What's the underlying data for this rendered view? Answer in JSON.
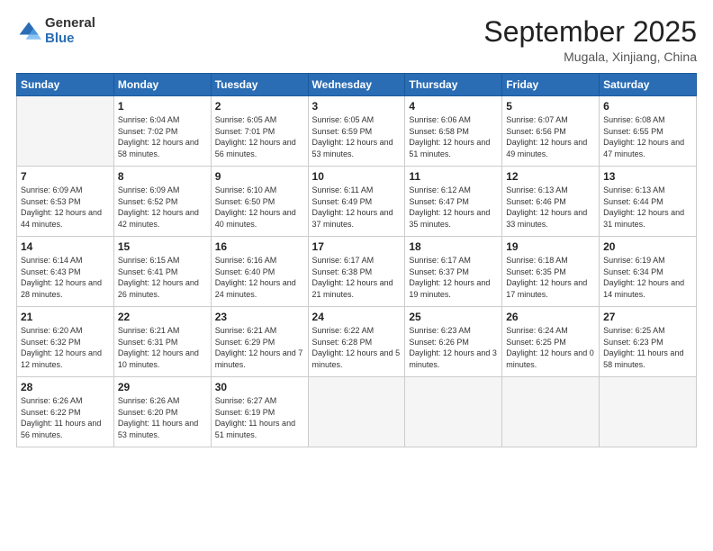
{
  "logo": {
    "general": "General",
    "blue": "Blue"
  },
  "title": "September 2025",
  "location": "Mugala, Xinjiang, China",
  "days_header": [
    "Sunday",
    "Monday",
    "Tuesday",
    "Wednesday",
    "Thursday",
    "Friday",
    "Saturday"
  ],
  "weeks": [
    [
      {
        "day": "",
        "sunrise": "",
        "sunset": "",
        "daylight": ""
      },
      {
        "day": "1",
        "sunrise": "6:04 AM",
        "sunset": "7:02 PM",
        "daylight": "12 hours and 58 minutes."
      },
      {
        "day": "2",
        "sunrise": "6:05 AM",
        "sunset": "7:01 PM",
        "daylight": "12 hours and 56 minutes."
      },
      {
        "day": "3",
        "sunrise": "6:05 AM",
        "sunset": "6:59 PM",
        "daylight": "12 hours and 53 minutes."
      },
      {
        "day": "4",
        "sunrise": "6:06 AM",
        "sunset": "6:58 PM",
        "daylight": "12 hours and 51 minutes."
      },
      {
        "day": "5",
        "sunrise": "6:07 AM",
        "sunset": "6:56 PM",
        "daylight": "12 hours and 49 minutes."
      },
      {
        "day": "6",
        "sunrise": "6:08 AM",
        "sunset": "6:55 PM",
        "daylight": "12 hours and 47 minutes."
      }
    ],
    [
      {
        "day": "7",
        "sunrise": "6:09 AM",
        "sunset": "6:53 PM",
        "daylight": "12 hours and 44 minutes."
      },
      {
        "day": "8",
        "sunrise": "6:09 AM",
        "sunset": "6:52 PM",
        "daylight": "12 hours and 42 minutes."
      },
      {
        "day": "9",
        "sunrise": "6:10 AM",
        "sunset": "6:50 PM",
        "daylight": "12 hours and 40 minutes."
      },
      {
        "day": "10",
        "sunrise": "6:11 AM",
        "sunset": "6:49 PM",
        "daylight": "12 hours and 37 minutes."
      },
      {
        "day": "11",
        "sunrise": "6:12 AM",
        "sunset": "6:47 PM",
        "daylight": "12 hours and 35 minutes."
      },
      {
        "day": "12",
        "sunrise": "6:13 AM",
        "sunset": "6:46 PM",
        "daylight": "12 hours and 33 minutes."
      },
      {
        "day": "13",
        "sunrise": "6:13 AM",
        "sunset": "6:44 PM",
        "daylight": "12 hours and 31 minutes."
      }
    ],
    [
      {
        "day": "14",
        "sunrise": "6:14 AM",
        "sunset": "6:43 PM",
        "daylight": "12 hours and 28 minutes."
      },
      {
        "day": "15",
        "sunrise": "6:15 AM",
        "sunset": "6:41 PM",
        "daylight": "12 hours and 26 minutes."
      },
      {
        "day": "16",
        "sunrise": "6:16 AM",
        "sunset": "6:40 PM",
        "daylight": "12 hours and 24 minutes."
      },
      {
        "day": "17",
        "sunrise": "6:17 AM",
        "sunset": "6:38 PM",
        "daylight": "12 hours and 21 minutes."
      },
      {
        "day": "18",
        "sunrise": "6:17 AM",
        "sunset": "6:37 PM",
        "daylight": "12 hours and 19 minutes."
      },
      {
        "day": "19",
        "sunrise": "6:18 AM",
        "sunset": "6:35 PM",
        "daylight": "12 hours and 17 minutes."
      },
      {
        "day": "20",
        "sunrise": "6:19 AM",
        "sunset": "6:34 PM",
        "daylight": "12 hours and 14 minutes."
      }
    ],
    [
      {
        "day": "21",
        "sunrise": "6:20 AM",
        "sunset": "6:32 PM",
        "daylight": "12 hours and 12 minutes."
      },
      {
        "day": "22",
        "sunrise": "6:21 AM",
        "sunset": "6:31 PM",
        "daylight": "12 hours and 10 minutes."
      },
      {
        "day": "23",
        "sunrise": "6:21 AM",
        "sunset": "6:29 PM",
        "daylight": "12 hours and 7 minutes."
      },
      {
        "day": "24",
        "sunrise": "6:22 AM",
        "sunset": "6:28 PM",
        "daylight": "12 hours and 5 minutes."
      },
      {
        "day": "25",
        "sunrise": "6:23 AM",
        "sunset": "6:26 PM",
        "daylight": "12 hours and 3 minutes."
      },
      {
        "day": "26",
        "sunrise": "6:24 AM",
        "sunset": "6:25 PM",
        "daylight": "12 hours and 0 minutes."
      },
      {
        "day": "27",
        "sunrise": "6:25 AM",
        "sunset": "6:23 PM",
        "daylight": "11 hours and 58 minutes."
      }
    ],
    [
      {
        "day": "28",
        "sunrise": "6:26 AM",
        "sunset": "6:22 PM",
        "daylight": "11 hours and 56 minutes."
      },
      {
        "day": "29",
        "sunrise": "6:26 AM",
        "sunset": "6:20 PM",
        "daylight": "11 hours and 53 minutes."
      },
      {
        "day": "30",
        "sunrise": "6:27 AM",
        "sunset": "6:19 PM",
        "daylight": "11 hours and 51 minutes."
      },
      {
        "day": "",
        "sunrise": "",
        "sunset": "",
        "daylight": ""
      },
      {
        "day": "",
        "sunrise": "",
        "sunset": "",
        "daylight": ""
      },
      {
        "day": "",
        "sunrise": "",
        "sunset": "",
        "daylight": ""
      },
      {
        "day": "",
        "sunrise": "",
        "sunset": "",
        "daylight": ""
      }
    ]
  ]
}
